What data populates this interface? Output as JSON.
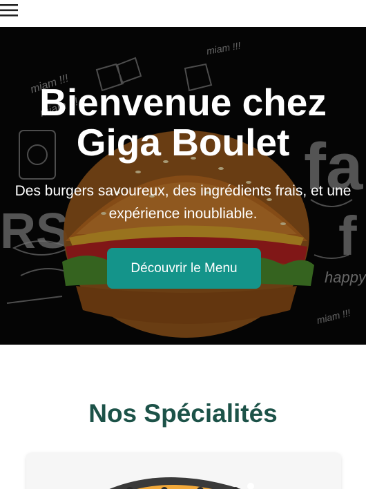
{
  "header": {
    "menu_icon": "hamburger-menu-icon"
  },
  "hero": {
    "title_line1": "Bienvenue chez",
    "title_line2": "Giga Boulet",
    "subtitle": "Des burgers savoureux, des ingrédients frais, et une expérience inoubliable.",
    "cta_label": "Découvrir le Menu",
    "cta_color": "#14948a"
  },
  "specialties": {
    "title": "Nos Spécialités",
    "title_color": "#1c5248"
  }
}
